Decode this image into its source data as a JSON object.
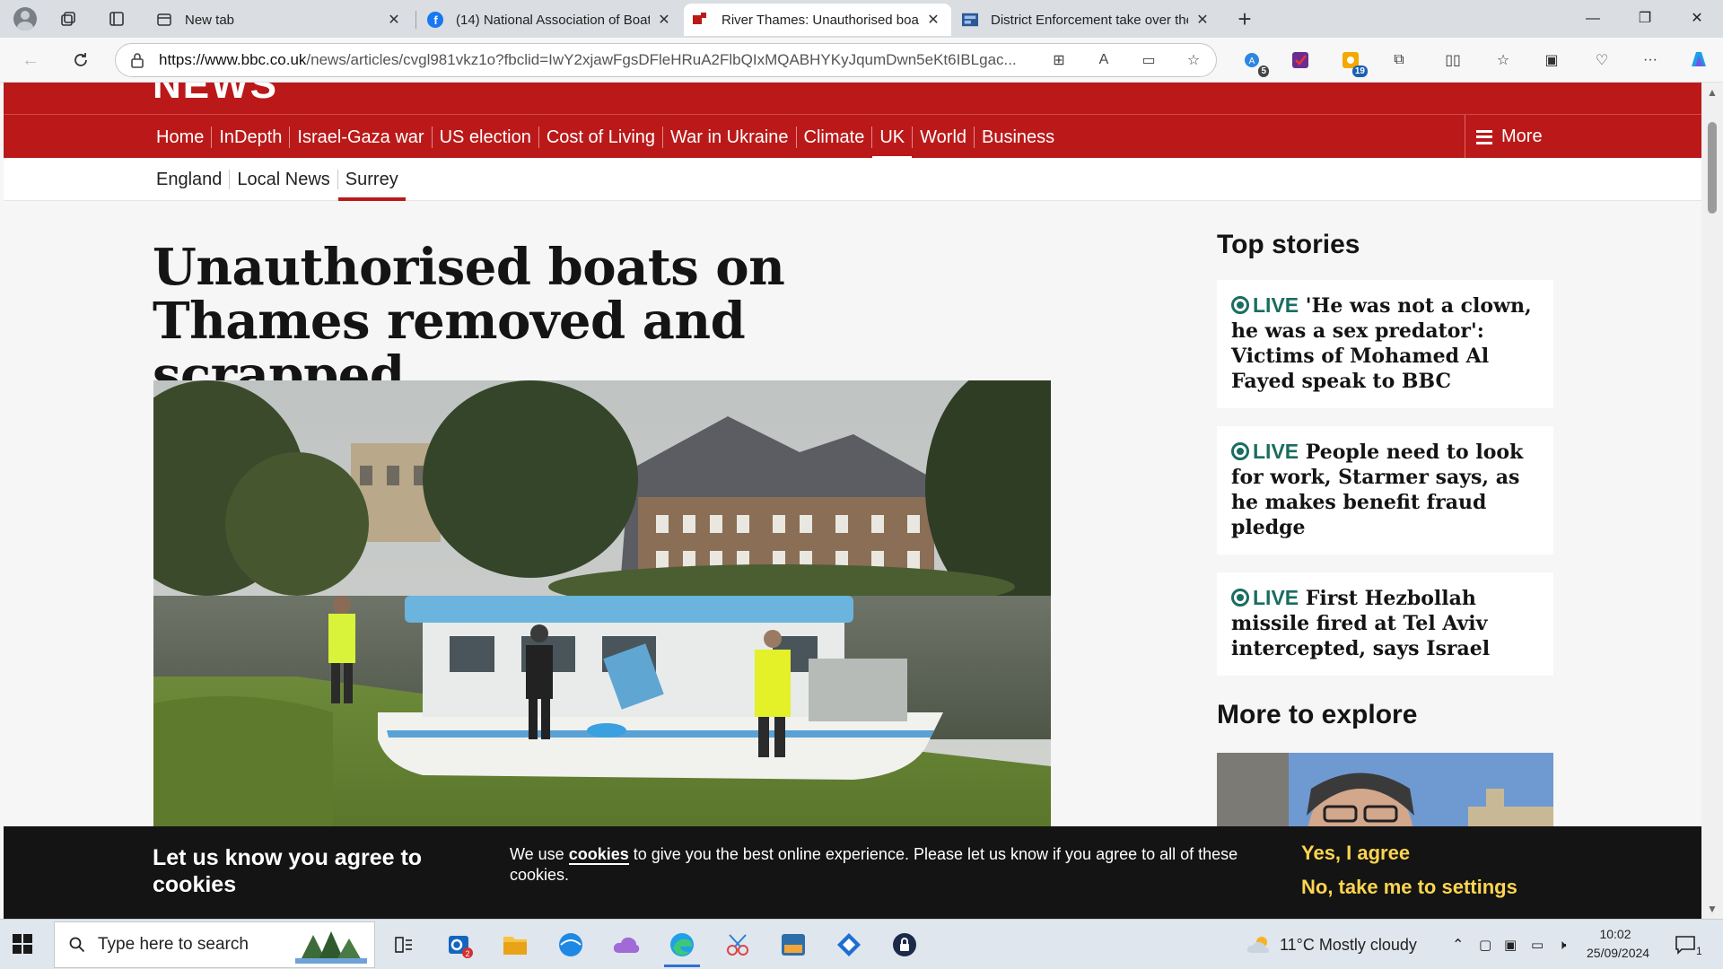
{
  "browser": {
    "tabs": [
      {
        "title": "New tab",
        "icon": "newtab-icon",
        "active": false
      },
      {
        "title": "(14) National Association of Boat",
        "icon": "facebook-icon",
        "active": false
      },
      {
        "title": "River Thames: Unauthorised boat",
        "icon": "bbc-icon",
        "active": true
      },
      {
        "title": "District Enforcement take over the",
        "icon": "site-icon",
        "active": false
      }
    ],
    "url_host": "https://www.bbc.co.uk",
    "url_path": "/news/articles/cvgl981vkz1o?fbclid=IwY2xjawFgsDFleHRuA2FlbQIxMQABHYKyJqumDwn5eKt6IBLgac...",
    "badges": {
      "ext1": "5",
      "ext3": "19"
    }
  },
  "bbc": {
    "logo_fragment": "NEWS",
    "nav": [
      "Home",
      "InDepth",
      "Israel-Gaza war",
      "US election",
      "Cost of Living",
      "War in Ukraine",
      "Climate",
      "UK",
      "World",
      "Business"
    ],
    "nav_current": "UK",
    "more_label": "More",
    "subnav": [
      "England",
      "Local News",
      "Surrey"
    ],
    "subnav_current": "Surrey"
  },
  "article": {
    "headline": "Unauthorised boats on Thames removed and scrapped"
  },
  "sidebar": {
    "top_stories_title": "Top stories",
    "stories": [
      {
        "live": "LIVE",
        "text": "'He was not a clown, he was a sex predator': Victims of Mohamed Al Fayed speak to BBC"
      },
      {
        "live": "LIVE",
        "text": "People need to look for work, Starmer says, as he makes benefit fraud pledge"
      },
      {
        "live": "LIVE",
        "text": "First Hezbollah missile fired at Tel Aviv intercepted, says Israel"
      }
    ],
    "explore_title": "More to explore"
  },
  "cookie": {
    "title": "Let us know you agree to cookies",
    "msg_before": "We use ",
    "msg_link": "cookies",
    "msg_after": " to give you the best online experience. Please let us know if you agree to all of these cookies.",
    "agree": "Yes, I agree",
    "settings": "No, take me to settings"
  },
  "taskbar": {
    "search_placeholder": "Type here to search",
    "weather": "11°C  Mostly cloudy",
    "time": "10:02",
    "date": "25/09/2024",
    "mail_badge": "2",
    "notif_count": "1"
  },
  "colors": {
    "bbc_red": "#bb1919",
    "live_green": "#1a6d60",
    "cookie_yellow": "#fdd54f"
  }
}
